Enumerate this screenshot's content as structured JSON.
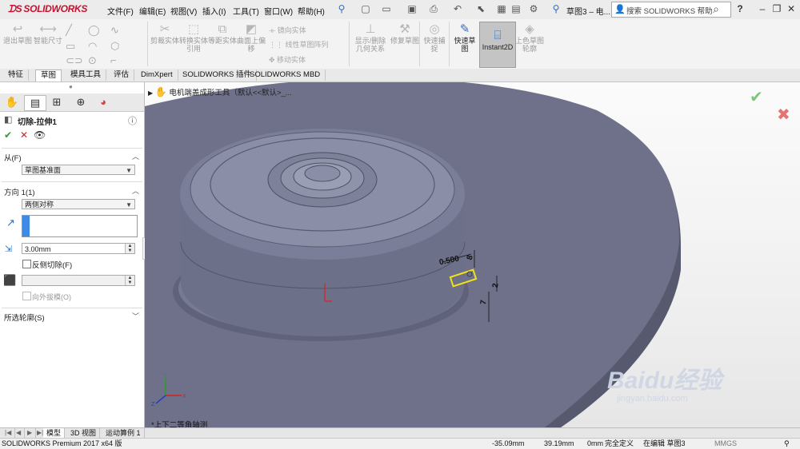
{
  "app": {
    "logo_text": "SOLIDWORKS",
    "doc_title": "草图3 – 电..."
  },
  "menu": [
    "文件(F)",
    "编辑(E)",
    "视图(V)",
    "插入(I)",
    "工具(T)",
    "窗口(W)",
    "帮助(H)"
  ],
  "search": {
    "placeholder": "搜索 SOLIDWORKS 帮助"
  },
  "window_controls": {
    "help": "?",
    "minimize": "–",
    "restore": "❐",
    "close": "✕"
  },
  "commands": {
    "exit_sketch": "退出草图",
    "smart_dim": "智能尺寸",
    "trim": "剪裁实体",
    "convert": "转换实体引用",
    "offset": "等距实体",
    "surface_offset": "曲面上偏移",
    "mirror": "镜向实体",
    "linear_pattern": "线性草图阵列",
    "move": "移动实体",
    "display_delete": "显示/删除几何关系",
    "repair": "修复草图",
    "quick_snap": "快速捕捉",
    "quick_sketch": "快速草图",
    "instant2d": "Instant2D",
    "shaded_sketch": "上色草图轮廓"
  },
  "tabs": [
    "特征",
    "草图",
    "模具工具",
    "评估",
    "DimXpert",
    "SOLIDWORKS 插件",
    "SOLIDWORKS MBD"
  ],
  "active_tab_index": 1,
  "feature": {
    "title": "切除-拉伸1",
    "from_label": "从(F)",
    "from_value": "草图基准面",
    "direction_label": "方向 1(1)",
    "end_condition": "两侧对称",
    "depth": "3.00mm",
    "flip_label": "反侧切除(F)",
    "draft_label": "向外拔模(O)",
    "contours_label": "所选轮廓(S)"
  },
  "viewport": {
    "tree_flyout": "电机端盖成形工具（默认<<默认>_...",
    "view_label": "*上下二等角轴测",
    "dimensions": [
      "0.500",
      "8",
      "2",
      "7"
    ]
  },
  "bottom_tabs": [
    "模型",
    "3D 视图",
    "运动算例 1"
  ],
  "status": {
    "edition": "SOLIDWORKS Premium 2017 x64 版",
    "x": "-35.09mm",
    "y": "39.19mm",
    "z": "0mm",
    "define_state": "完全定义",
    "editing": "在编辑 草图3",
    "units": "MMGS"
  },
  "watermark": {
    "brand": "Baidu经验",
    "url": "jingyan.baidu.com"
  },
  "colors": {
    "accent_red": "#c8102e",
    "model_fill": "#6b6f86",
    "ok_green": "#3aa335"
  }
}
